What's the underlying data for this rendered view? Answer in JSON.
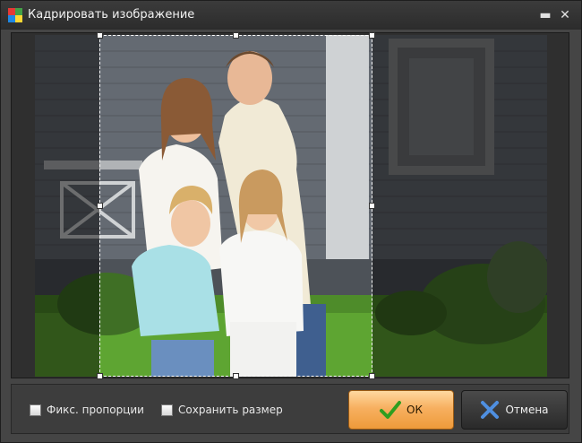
{
  "window": {
    "title": "Кадрировать изображение",
    "minimize_glyph": "▬",
    "close_glyph": "✕"
  },
  "options": {
    "fix_proportions_label": "Фикс. пропорции",
    "keep_size_label": "Сохранить размер",
    "fix_proportions_checked": false,
    "keep_size_checked": false
  },
  "buttons": {
    "ok_label": "ОК",
    "cancel_label": "Отмена"
  },
  "photo": {
    "subject": "Family of four standing in front of a grey house on a lawn"
  },
  "icons": {
    "app": "app-logo-icon",
    "ok": "checkmark-icon",
    "cancel": "cross-icon"
  }
}
